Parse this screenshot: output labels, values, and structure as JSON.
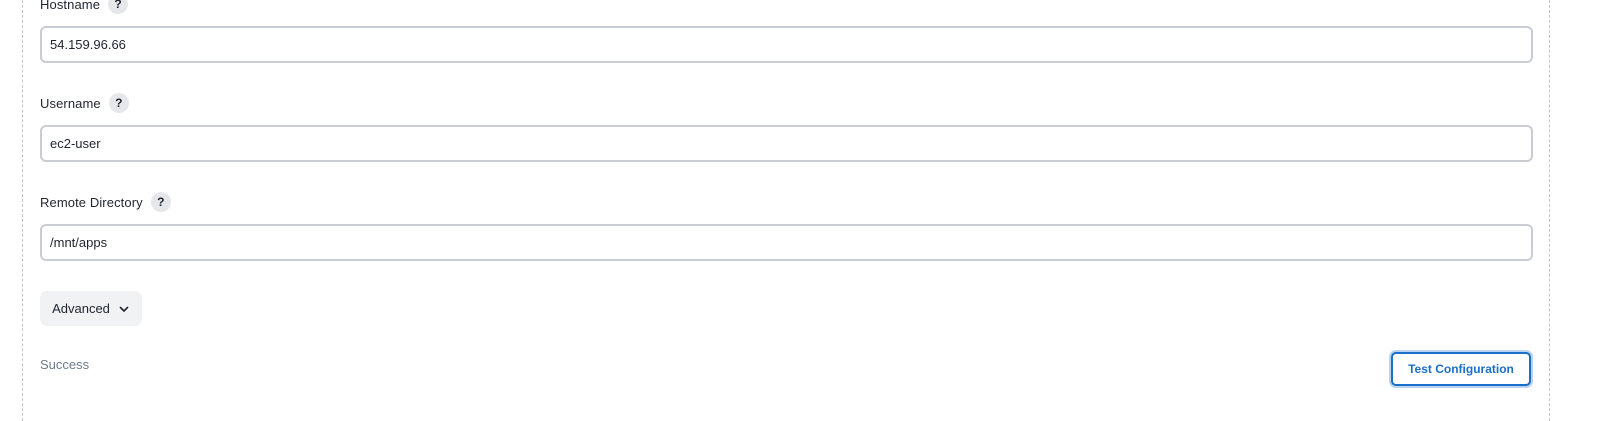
{
  "fields": {
    "hostname": {
      "label": "Hostname",
      "value": "54.159.96.66"
    },
    "username": {
      "label": "Username",
      "value": "ec2-user"
    },
    "remote_directory": {
      "label": "Remote Directory",
      "value": "/mnt/apps"
    }
  },
  "help_symbol": "?",
  "advanced": {
    "label": "Advanced",
    "icon": "chevron-down-icon"
  },
  "status": {
    "text": "Success"
  },
  "test_button": {
    "label": "Test Configuration"
  },
  "colors": {
    "accent": "#1b6fc9",
    "field_border": "#c9cdd3",
    "status_text": "#6f7a8a",
    "help_bg": "#e6e7ea"
  }
}
